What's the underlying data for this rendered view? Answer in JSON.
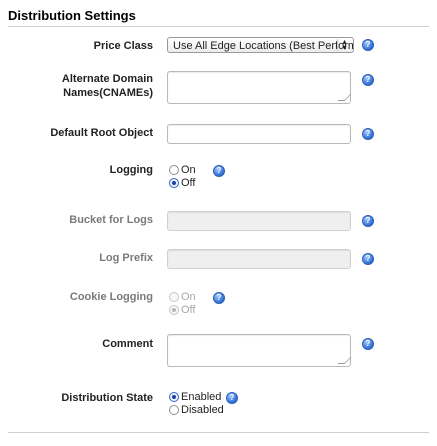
{
  "section": {
    "title": "Distribution Settings"
  },
  "fields": {
    "price_class": {
      "label": "Price Class",
      "value": "Use All Edge Locations (Best Perform"
    },
    "cnames": {
      "label_line1": "Alternate Domain",
      "label_line2": "Names(CNAMEs)",
      "value": ""
    },
    "root_object": {
      "label": "Default Root Object",
      "value": ""
    },
    "logging": {
      "label": "Logging",
      "on": "On",
      "off": "Off",
      "selected": "Off"
    },
    "bucket": {
      "label": "Bucket for Logs",
      "value": ""
    },
    "log_prefix": {
      "label": "Log Prefix",
      "value": ""
    },
    "cookie_logging": {
      "label": "Cookie Logging",
      "on": "On",
      "off": "Off",
      "selected": "Off"
    },
    "comment": {
      "label": "Comment",
      "value": ""
    },
    "state": {
      "label": "Distribution State",
      "enabled": "Enabled",
      "disabled": "Disabled",
      "selected": "Enabled"
    }
  },
  "icons": {
    "help": "help-icon",
    "select_arrows": "select-arrows-icon",
    "resize_grip": "resize-grip-icon"
  },
  "colors": {
    "help_icon": "#2f6fd6",
    "disabled_text": "#7a7a7a"
  }
}
